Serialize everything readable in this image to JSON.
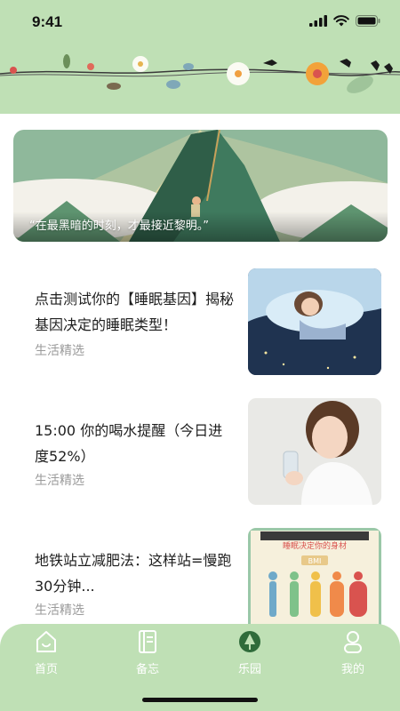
{
  "status_bar": {
    "time": "9:41"
  },
  "banner": {
    "quote": "“在最黑暗的时刻，才最接近黎明。”"
  },
  "articles": [
    {
      "title": "点击测试你的【睡眠基因】揭秘基因决定的睡眠类型！",
      "tag": "生活精选",
      "thumb_icon": "sleeping-girl-illustration"
    },
    {
      "title": "15:00 你的喝水提醒（今日进度52%）",
      "tag": "生活精选",
      "thumb_icon": "woman-drinking-water-photo"
    },
    {
      "title": "地铁站立减肥法：这样站=慢跑30分钟...",
      "tag": "生活精选",
      "thumb_icon": "bmi-body-shapes-chart",
      "thumb_text": {
        "subtitle": "睡眠决定你的身材",
        "label": "BMI"
      }
    }
  ],
  "tabbar": {
    "items": [
      {
        "label": "首页",
        "icon": "home-icon"
      },
      {
        "label": "备忘",
        "icon": "notebook-icon"
      },
      {
        "label": "乐园",
        "icon": "park-icon",
        "active": true
      },
      {
        "label": "我的",
        "icon": "profile-icon"
      }
    ]
  },
  "colors": {
    "header_bg": "#bfe0b5",
    "tabbar_bg": "#bfe0b5",
    "active_tab": "#2f6b3a",
    "tag_text": "#9a9a9a"
  }
}
